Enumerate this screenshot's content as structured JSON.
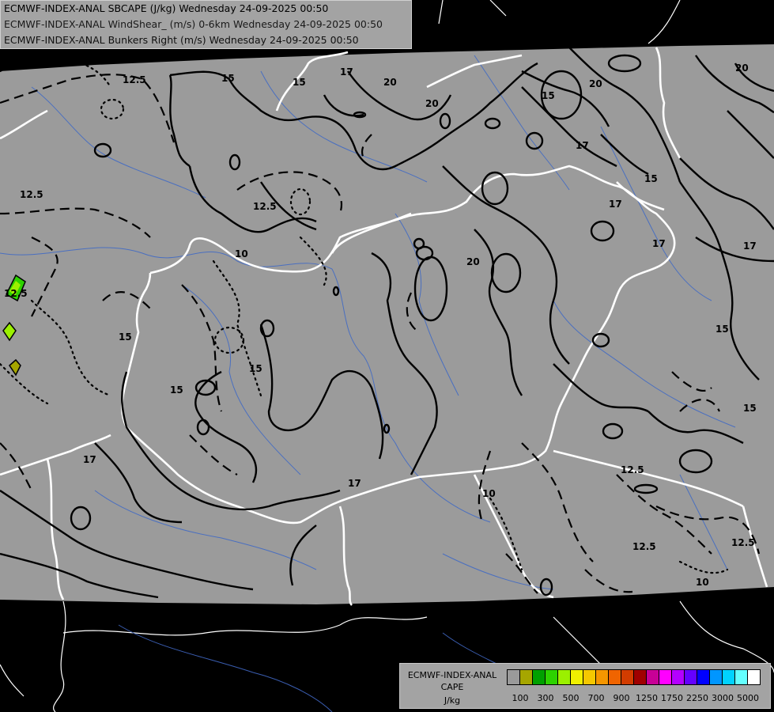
{
  "titles": [
    "ECMWF-INDEX-ANAL SBCAPE (J/kg) Wednesday 24-09-2025 00:50",
    "ECMWF-INDEX-ANAL WindShear_ (m/s) 0-6km Wednesday 24-09-2025 00:50",
    "ECMWF-INDEX-ANAL Bunkers Right (m/s) Wednesday 24-09-2025 00:50"
  ],
  "legend": {
    "line1": "ECMWF-INDEX-ANAL",
    "line2": "CAPE",
    "line3": "J/kg",
    "colors": [
      "#9a9a9a",
      "#a6a600",
      "#00a000",
      "#2dd200",
      "#9bf000",
      "#f0f000",
      "#f5c800",
      "#f59600",
      "#f06400",
      "#d23c00",
      "#a00000",
      "#c80096",
      "#ff00ff",
      "#b400ff",
      "#6400ff",
      "#0000ff",
      "#0096ff",
      "#00d2ff",
      "#64ffff",
      "#ffffff"
    ],
    "ticks": [
      "100",
      "300",
      "500",
      "700",
      "900",
      "1250",
      "1750",
      "2250",
      "3000",
      "5000"
    ]
  },
  "contour_labels": [
    "10",
    "10",
    "12.5",
    "15",
    "15",
    "17",
    "20",
    "20",
    "12.5",
    "12.5",
    "10",
    "15",
    "15",
    "20",
    "15",
    "17",
    "17",
    "17",
    "17",
    "17",
    "15",
    "12.5",
    "10",
    "12.5",
    "12.5",
    "10",
    "15",
    "15",
    "20",
    "12.5",
    "20",
    "15",
    "17"
  ]
}
